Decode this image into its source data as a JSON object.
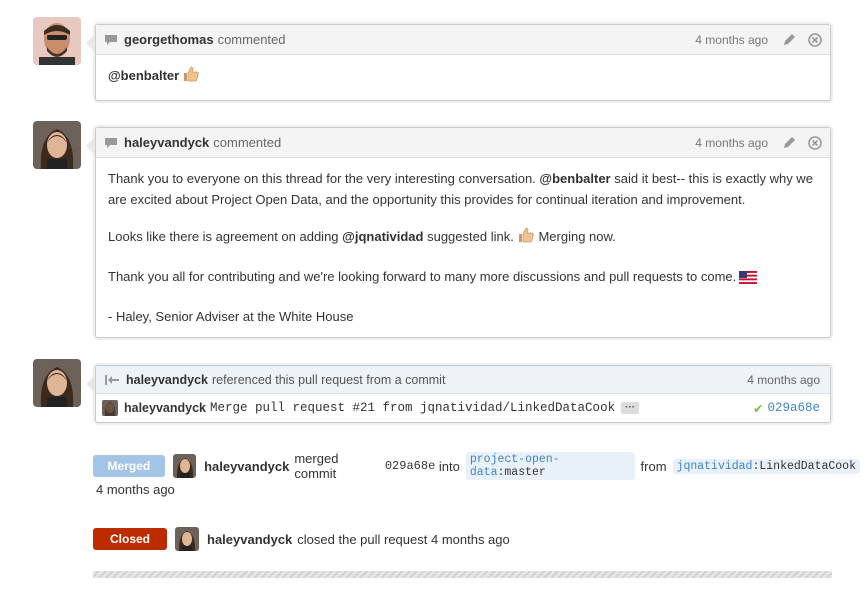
{
  "comments": [
    {
      "author": "georgethomas",
      "action": "commented",
      "time": "4 months ago",
      "body_mention": "@benbalter"
    },
    {
      "author": "haleyvandyck",
      "action": "commented",
      "time": "4 months ago",
      "p1_a": "Thank you to everyone on this thread for the very interesting conversation.",
      "p1_mention": "@benbalter",
      "p1_b": "said it best-- this is exactly why we are excited about Project Open Data, and the opportunity this provides for continual iteration and improvement.",
      "p2_a": "Looks like there is agreement on adding",
      "p2_mention": "@jqnatividad",
      "p2_b": "suggested link.",
      "p2_c": "Merging now.",
      "p3": "Thank you all for contributing and we're looking forward to many more discussions and pull requests to come.",
      "p4": "- Haley, Senior Adviser at the White House"
    }
  ],
  "reference": {
    "author": "haleyvandyck",
    "text": "referenced this pull request from a commit",
    "time": "4 months ago",
    "commit_author": "haleyvandyck",
    "commit_message": "Merge pull request #21 from jqnatividad/LinkedDataCook",
    "ellipsis": "···",
    "sha": "029a68e"
  },
  "merged_event": {
    "state": "Merged",
    "author": "haleyvandyck",
    "text": "merged commit",
    "sha": "029a68e",
    "into": "into",
    "base_repo": "project-open-data",
    "base_branch": ":master",
    "from": "from",
    "head_repo": "jqnatividad",
    "head_branch": ":LinkedDataCook",
    "time": "4 months ago"
  },
  "closed_event": {
    "state": "Closed",
    "author": "haleyvandyck",
    "text": "closed the pull request 4 months ago"
  },
  "colors": {
    "merged": "#a3c4e6",
    "closed": "#bd2c00",
    "link": "#4183c4",
    "check": "#6cc644"
  }
}
